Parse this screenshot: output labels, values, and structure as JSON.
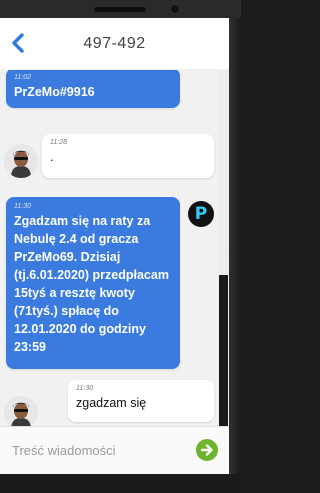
{
  "header": {
    "title": "497-492"
  },
  "messages": [
    {
      "type": "sent",
      "time": "11:02",
      "text": "PrZeMo#9916"
    },
    {
      "type": "recv",
      "time": "11:28",
      "text": "."
    },
    {
      "type": "sent",
      "time": "11:30",
      "text": "Zgadzam się na raty za Nebulę 2.4 od gracza PrZeMo69. Dzisiaj (tj.6.01.2020) przedpłacam 15tyś a resztę kwoty (71tyś.) spłacę do 12.01.2020 do godziny 23:59"
    },
    {
      "type": "recv",
      "time": "11:30",
      "text": "zgadzam się"
    }
  ],
  "sender_avatar_letter": "P",
  "input": {
    "placeholder": "Treść wiadomości",
    "value": ""
  },
  "colors": {
    "sent_bubble": "#3b7be0",
    "send_button": "#6fb42f",
    "back_arrow": "#2a7ae2",
    "p_letter": "#35c9f2"
  }
}
